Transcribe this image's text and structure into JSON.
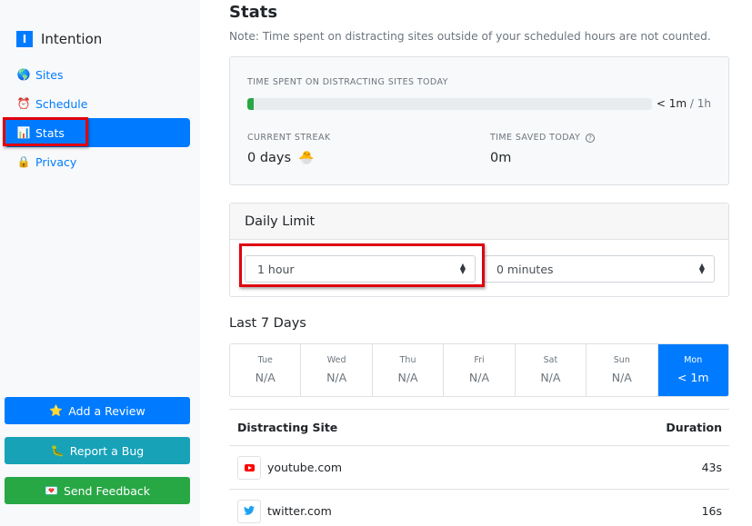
{
  "sidebar": {
    "brand": {
      "logo_letter": "I",
      "name": "Intention"
    },
    "items": [
      {
        "id": "sites",
        "label": "Sites",
        "icon": "globe-icon",
        "glyph": "🌎",
        "active": false
      },
      {
        "id": "schedule",
        "label": "Schedule",
        "icon": "alarm-clock-icon",
        "glyph": "⏰",
        "active": false
      },
      {
        "id": "stats",
        "label": "Stats",
        "icon": "bar-chart-icon",
        "glyph": "📊",
        "active": true
      },
      {
        "id": "privacy",
        "label": "Privacy",
        "icon": "lock-icon",
        "glyph": "🔒",
        "active": false
      }
    ],
    "buttons": {
      "review": {
        "label": "Add a Review",
        "glyph": "⭐",
        "color": "#007bff"
      },
      "bug": {
        "label": "Report a Bug",
        "glyph": "🐛",
        "color": "#17a2b8"
      },
      "feedback": {
        "label": "Send Feedback",
        "glyph": "💌",
        "color": "#28a745"
      }
    }
  },
  "main": {
    "title": "Stats",
    "note": "Note: Time spent on distracting sites outside of your scheduled hours are not counted.",
    "today": {
      "label": "Time spent on distracting sites today",
      "progress_percent": 1,
      "spent": "< 1m",
      "separator": " / ",
      "limit": "1h",
      "progress_color": "#28a745"
    },
    "streak": {
      "label": "Current Streak",
      "value": "0 days",
      "glyph": "🐣"
    },
    "saved": {
      "label": "Time Saved Today",
      "help_glyph": "?",
      "value": "0m"
    },
    "daily_limit": {
      "title": "Daily Limit",
      "hours": {
        "selected": "1 hour"
      },
      "minutes": {
        "selected": "0 minutes"
      }
    },
    "last7": {
      "title": "Last 7 Days",
      "days": [
        {
          "day": "Tue",
          "value": "N/A",
          "active": false
        },
        {
          "day": "Wed",
          "value": "N/A",
          "active": false
        },
        {
          "day": "Thu",
          "value": "N/A",
          "active": false
        },
        {
          "day": "Fri",
          "value": "N/A",
          "active": false
        },
        {
          "day": "Sat",
          "value": "N/A",
          "active": false
        },
        {
          "day": "Sun",
          "value": "N/A",
          "active": false
        },
        {
          "day": "Mon",
          "value": "< 1m",
          "active": true
        }
      ]
    },
    "sites_table": {
      "headers": {
        "site": "Distracting Site",
        "duration": "Duration"
      },
      "rows": [
        {
          "site": "youtube.com",
          "duration": "43s",
          "icon": "youtube-icon"
        },
        {
          "site": "twitter.com",
          "duration": "16s",
          "icon": "twitter-icon",
          "glyph": "🐦"
        }
      ]
    }
  },
  "colors": {
    "primary": "#007bff",
    "info": "#17a2b8",
    "success": "#28a745",
    "highlight": "#e0000f"
  }
}
